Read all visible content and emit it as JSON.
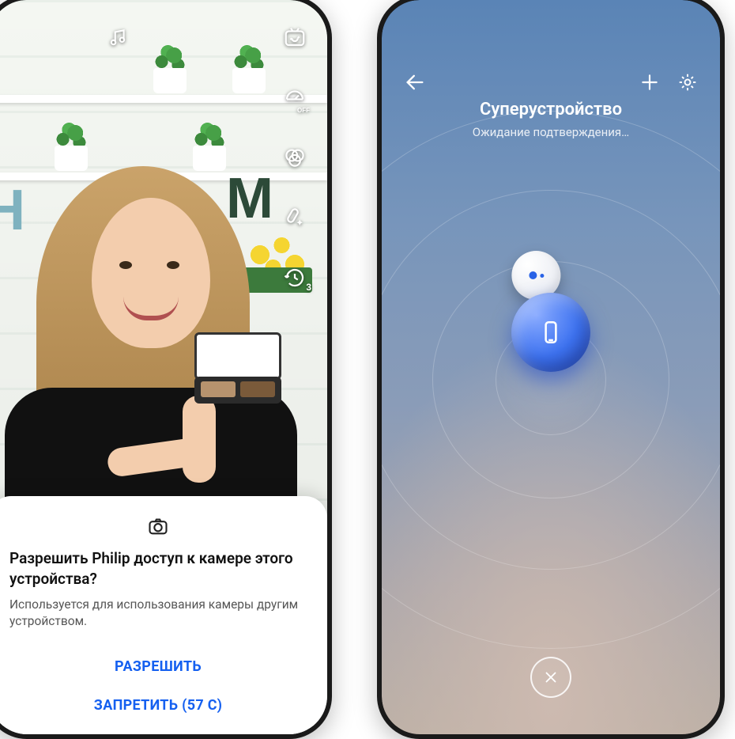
{
  "left": {
    "camera_icons": {
      "music": "music-icon",
      "flip": "camera-flip-icon",
      "timer_off": "speed-off-icon",
      "filters": "filters-icon",
      "beauty": "beauty-wand-icon",
      "history": "history-3-icon",
      "history_badge": "3"
    },
    "dialog": {
      "icon": "camera-icon",
      "title": "Разрешить Philip доступ к камере этого устройства?",
      "description": "Используется для использования камеры другим устройством.",
      "allow_label": "РАЗРЕШИТЬ",
      "deny_label": "ЗАПРЕТИТЬ (57 С)"
    }
  },
  "right": {
    "header": {
      "back": "back-icon",
      "add": "plus-icon",
      "settings": "gear-icon"
    },
    "title": "Суперустройство",
    "subtitle": "Ожидание подтверждения…",
    "devices": {
      "center": "phone-device-icon",
      "satellite": "device-dots-icon"
    },
    "close": "close-icon"
  }
}
